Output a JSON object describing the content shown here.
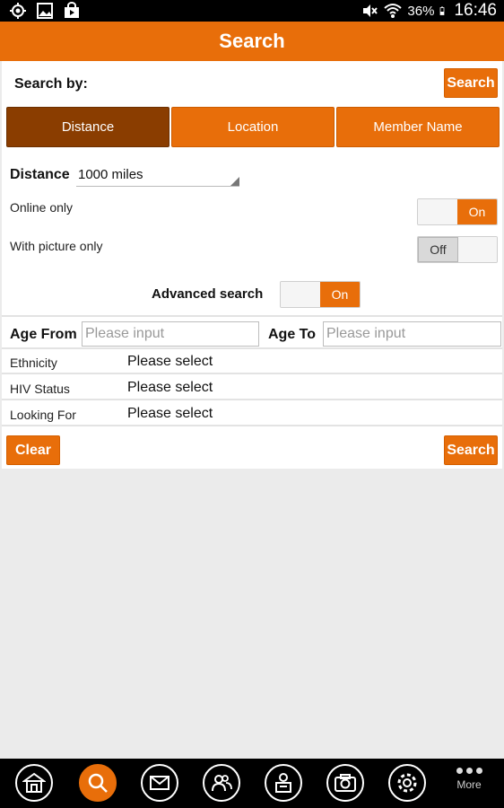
{
  "status_bar": {
    "battery": "36%",
    "time": "16:46",
    "icons": [
      "gps-icon",
      "image-icon",
      "store-icon",
      "mute-icon",
      "wifi-icon",
      "battery-icon"
    ]
  },
  "header": {
    "title": "Search"
  },
  "search_by": {
    "label": "Search by:",
    "search_button": "Search",
    "tabs": [
      {
        "label": "Distance",
        "active": true
      },
      {
        "label": "Location",
        "active": false
      },
      {
        "label": "Member Name",
        "active": false
      }
    ]
  },
  "distance": {
    "label": "Distance",
    "value": "1000 miles"
  },
  "options": {
    "online_only": {
      "label": "Online only",
      "state": "On"
    },
    "with_picture": {
      "label": "With picture only",
      "state": "Off"
    },
    "advanced_search": {
      "label": "Advanced search",
      "state": "On"
    }
  },
  "age": {
    "from_label": "Age From",
    "from_placeholder": "Please input",
    "to_label": "Age To",
    "to_placeholder": "Please input"
  },
  "filters": [
    {
      "label": "Ethnicity",
      "value": "Please select"
    },
    {
      "label": "HIV Status",
      "value": "Please select"
    },
    {
      "label": "Looking For",
      "value": "Please select"
    }
  ],
  "actions": {
    "clear": "Clear",
    "search": "Search"
  },
  "bottom_nav": {
    "items": [
      "home-icon",
      "search-icon",
      "mail-icon",
      "friends-icon",
      "profile-icon",
      "camera-icon",
      "settings-icon"
    ],
    "active": "search-icon",
    "more_label": "More"
  },
  "colors": {
    "accent": "#e86e0a",
    "accent_dark": "#8a3d00"
  }
}
